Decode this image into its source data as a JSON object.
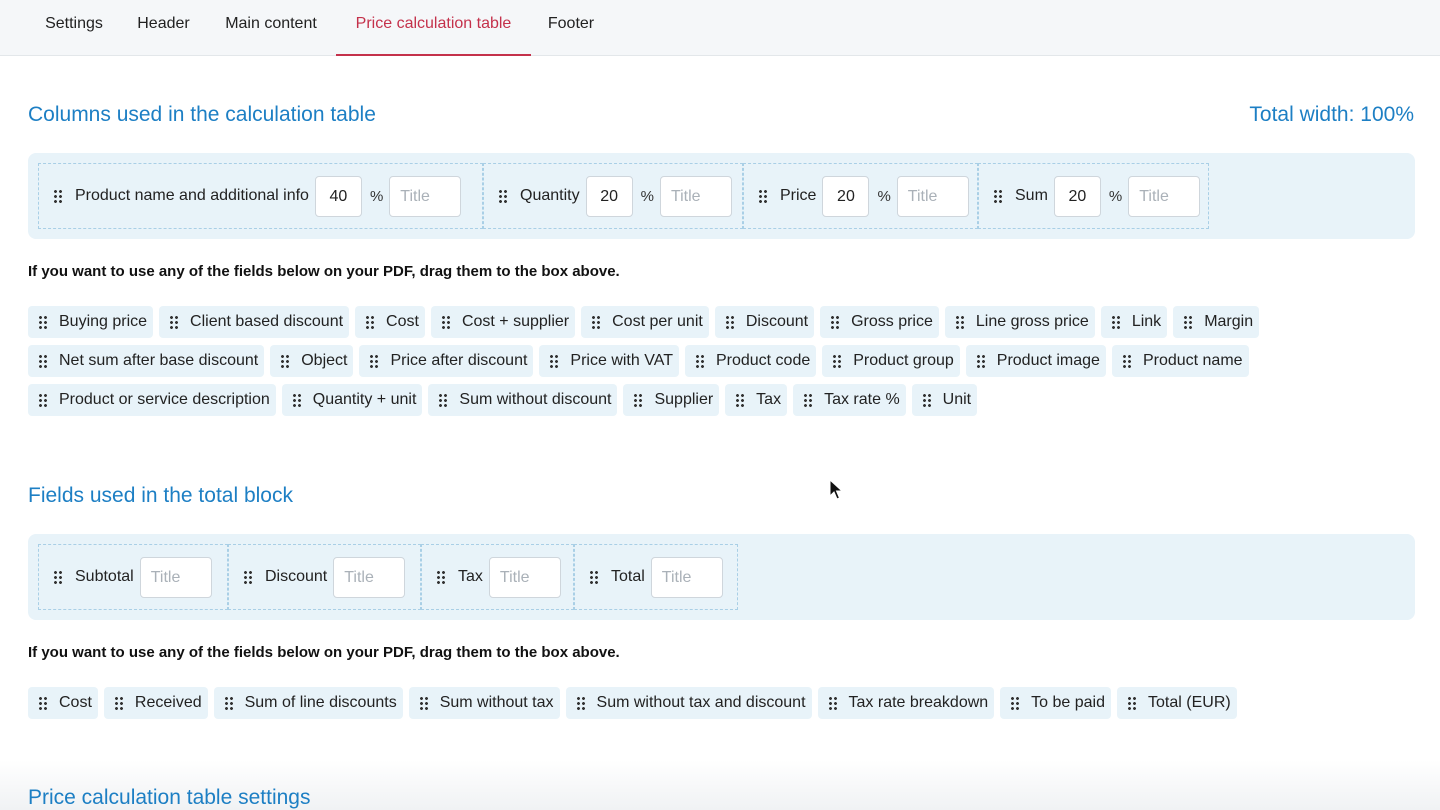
{
  "tabs": [
    {
      "label": "Settings",
      "active": false
    },
    {
      "label": "Header",
      "active": false
    },
    {
      "label": "Main content",
      "active": false
    },
    {
      "label": "Price calculation table",
      "active": true
    },
    {
      "label": "Footer",
      "active": false
    }
  ],
  "columns_section": {
    "title": "Columns used in the calculation table",
    "total_width": "Total width: 100%",
    "selected": [
      {
        "label": "Product name and additional info",
        "width": "40",
        "unit": "%",
        "title_placeholder": "Title"
      },
      {
        "label": "Quantity",
        "width": "20",
        "unit": "%",
        "title_placeholder": "Title"
      },
      {
        "label": "Price",
        "width": "20",
        "unit": "%",
        "title_placeholder": "Title"
      },
      {
        "label": "Sum",
        "width": "20",
        "unit": "%",
        "title_placeholder": "Title"
      }
    ],
    "hint": "If you want to use any of the fields below on your PDF, drag them to the box above.",
    "available": [
      "Buying price",
      "Client based discount",
      "Cost",
      "Cost + supplier",
      "Cost per unit",
      "Discount",
      "Gross price",
      "Line gross price",
      "Link",
      "Margin",
      "Net sum after base discount",
      "Object",
      "Price after discount",
      "Price with VAT",
      "Product code",
      "Product group",
      "Product image",
      "Product name",
      "Product or service description",
      "Quantity + unit",
      "Sum without discount",
      "Supplier",
      "Tax",
      "Tax rate %",
      "Unit"
    ]
  },
  "totals_section": {
    "title": "Fields used in the total block",
    "selected": [
      {
        "label": "Subtotal",
        "title_placeholder": "Title"
      },
      {
        "label": "Discount",
        "title_placeholder": "Title"
      },
      {
        "label": "Tax",
        "title_placeholder": "Title"
      },
      {
        "label": "Total",
        "title_placeholder": "Title"
      }
    ],
    "hint": "If you want to use any of the fields below on your PDF, drag them to the box above.",
    "available": [
      "Cost",
      "Received",
      "Sum of line discounts",
      "Sum without tax",
      "Sum without tax and discount",
      "Tax rate breakdown",
      "To be paid",
      "Total (EUR)"
    ]
  },
  "settings_section": {
    "title": "Price calculation table settings"
  },
  "colors": {
    "accent": "#1d7fc4",
    "active_tab": "#c4314b",
    "box_bg": "#e8f3f9"
  }
}
